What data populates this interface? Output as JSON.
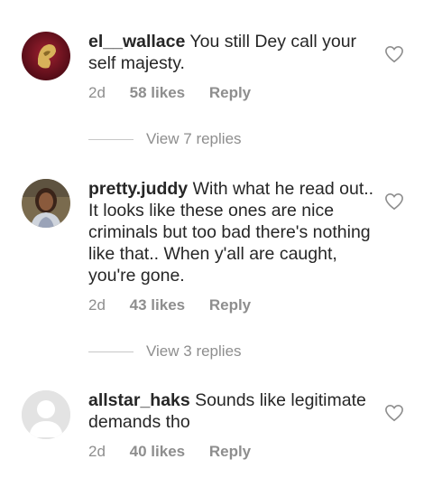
{
  "comments": [
    {
      "username": "el__wallace",
      "text": "You still Dey call your self majesty.",
      "time": "2d",
      "likes": "58 likes",
      "reply": "Reply",
      "view_replies": "View 7 replies",
      "avatar_icon": "gold-brooch-avatar"
    },
    {
      "username": "pretty.juddy",
      "text": "With what he read out.. It looks like these ones are nice criminals but too bad there's nothing like that.. When y'all are caught, you're gone.",
      "time": "2d",
      "likes": "43 likes",
      "reply": "Reply",
      "view_replies": "View 3 replies",
      "avatar_icon": "woman-photo-avatar"
    },
    {
      "username": "allstar_haks",
      "text": "Sounds like legitimate demands tho",
      "time": "2d",
      "likes": "40 likes",
      "reply": "Reply",
      "avatar_icon": "default-user-avatar"
    }
  ],
  "colors": {
    "text": "#262626",
    "secondary": "#8e8e8e",
    "divider": "#c7c7c7"
  }
}
